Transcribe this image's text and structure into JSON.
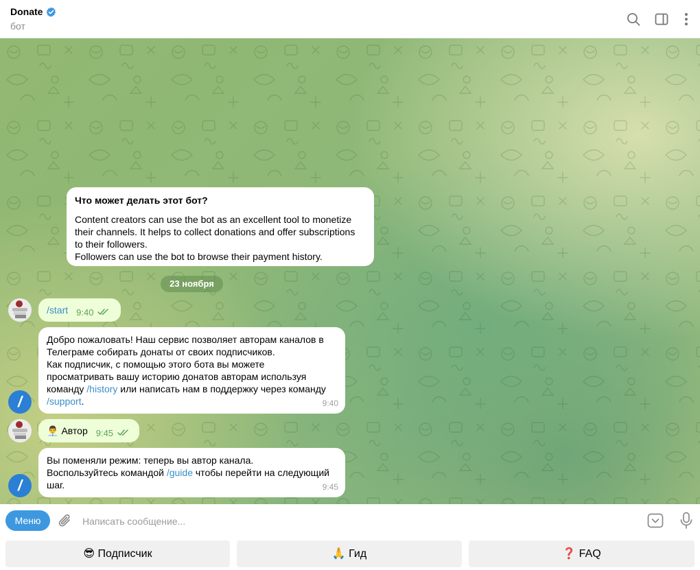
{
  "header": {
    "title": "Donate",
    "subtitle": "бот"
  },
  "intro": {
    "title": "Что может делать этот бот?",
    "line1": "Content creators can use the bot as  an excellent tool to monetize",
    "line2": "their channels. It helps to collect donations and offer subscriptions",
    "line3": "to their followers.",
    "line4": "Followers can use the bot to browse their payment history."
  },
  "date_separator": "23 ноября",
  "messages": [
    {
      "text": "/start",
      "time": "9:40"
    },
    {
      "line1": "Добро пожаловать! Наш сервис позволяет авторам каналов в",
      "line2": "Телеграме собирать донаты от своих подписчиков.",
      "line3": "Как подписчик, с помощью этого бота вы можете",
      "line4": "просматривать вашу историю донатов авторам используя",
      "line5a": "команду ",
      "cmd_history": "/history",
      "line5b": " или написать нам в поддержку через команду",
      "cmd_support": "/support",
      "line6b": ".",
      "time": "9:40"
    },
    {
      "emoji": "👨‍💼",
      "text": "Автор",
      "time": "9:45"
    },
    {
      "line1": "Вы поменяли режим: теперь вы автор канала.",
      "line2a": "Воспользуйтесь командой ",
      "cmd_guide": "/guide",
      "line2b": " чтобы перейти на следующий",
      "line3": "шаг.",
      "time": "9:45"
    }
  ],
  "bot_avatar_glyph": "/",
  "input": {
    "menu_label": "Меню",
    "placeholder": "Написать сообщение..."
  },
  "keyboard": {
    "subscriber": "😎 Подписчик",
    "guide": "🙏 Гид",
    "faq": "❓ FAQ"
  },
  "colors": {
    "accent": "#3d98e0",
    "outgoing_bubble": "#eefed9",
    "check_green": "#5fa25b",
    "bot_avatar": "#2b7fd4"
  },
  "icons": [
    "verified-icon",
    "search-icon",
    "sidebar-toggle-icon",
    "more-vertical-icon",
    "attach-icon",
    "keyboard-icon",
    "microphone-icon",
    "double-check-icon"
  ]
}
